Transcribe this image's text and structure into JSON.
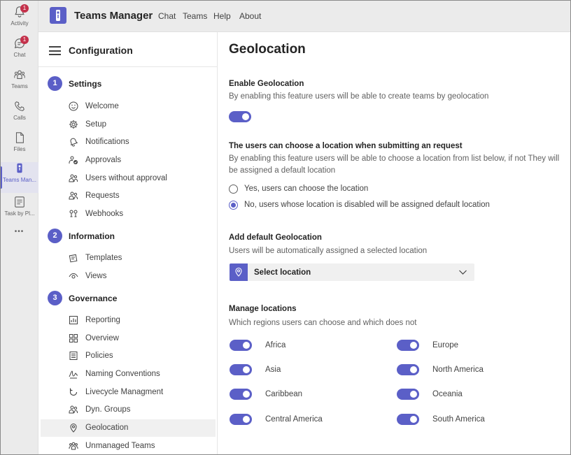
{
  "rail": {
    "items": [
      {
        "label": "Activity",
        "icon": "bell-icon",
        "badge": "1"
      },
      {
        "label": "Chat",
        "icon": "chat-icon",
        "badge": "1"
      },
      {
        "label": "Teams",
        "icon": "teams-icon"
      },
      {
        "label": "Calls",
        "icon": "phone-icon"
      },
      {
        "label": "Files",
        "icon": "file-icon"
      },
      {
        "label": "Teams Man...",
        "icon": "teams-manager-icon"
      },
      {
        "label": "Task by Pl...",
        "icon": "task-icon"
      }
    ],
    "more": "•••"
  },
  "header": {
    "app_title": "Teams Manager",
    "links": [
      "Chat",
      "Teams",
      "Help",
      "About"
    ]
  },
  "config": {
    "title": "Configuration",
    "sections": [
      {
        "number": "1",
        "title": "Settings",
        "items": [
          {
            "label": "Welcome",
            "icon": "smiley-icon"
          },
          {
            "label": "Setup",
            "icon": "gear-icon"
          },
          {
            "label": "Notifications",
            "icon": "bell-ring-icon"
          },
          {
            "label": "Approvals",
            "icon": "people-check-icon"
          },
          {
            "label": "Users without approval",
            "icon": "people-icon"
          },
          {
            "label": "Requests",
            "icon": "people-request-icon"
          },
          {
            "label": "Webhooks",
            "icon": "webhook-icon"
          }
        ]
      },
      {
        "number": "2",
        "title": "Information",
        "items": [
          {
            "label": "Templates",
            "icon": "template-icon"
          },
          {
            "label": "Views",
            "icon": "eye-icon"
          }
        ]
      },
      {
        "number": "3",
        "title": "Governance",
        "items": [
          {
            "label": "Reporting",
            "icon": "chart-icon"
          },
          {
            "label": "Overview",
            "icon": "grid-icon"
          },
          {
            "label": "Policies",
            "icon": "list-icon"
          },
          {
            "label": "Naming Conventions",
            "icon": "signature-icon"
          },
          {
            "label": "Livecycle Managment",
            "icon": "cycle-icon"
          },
          {
            "label": "Dyn. Groups",
            "icon": "group-icon"
          },
          {
            "label": "Geolocation",
            "icon": "location-pin-icon",
            "active": true
          },
          {
            "label": "Unmanaged Teams",
            "icon": "team-group-icon"
          }
        ]
      }
    ]
  },
  "main": {
    "title": "Geolocation",
    "enable": {
      "title": "Enable Geolocation",
      "description": "By enabling this feature users will be able to create teams by geolocation",
      "on": true
    },
    "choose": {
      "title": "The users can choose a location when submitting an request",
      "description_line1": "By enabling this feature users will be able to choose a location from list below, if not They will",
      "description_line2": "be assigned a default location",
      "options": [
        {
          "label": "Yes, users can choose the location",
          "checked": false
        },
        {
          "label": "No, users whose location is disabled will be assigned default location",
          "checked": true
        }
      ]
    },
    "default_geo": {
      "title": "Add default Geolocation",
      "description": "Users will be automatically assigned a selected location",
      "select_value": "Select location"
    },
    "manage": {
      "title": "Manage locations",
      "description": "Which regions users can choose and which does not",
      "regions": [
        {
          "label": "Africa",
          "on": true
        },
        {
          "label": "Europe",
          "on": true
        },
        {
          "label": "Asia",
          "on": true
        },
        {
          "label": "North America",
          "on": true
        },
        {
          "label": "Caribbean",
          "on": true
        },
        {
          "label": "Oceania",
          "on": true
        },
        {
          "label": "Central America",
          "on": true
        },
        {
          "label": "South America",
          "on": true
        }
      ]
    }
  },
  "colors": {
    "accent": "#5b5fc7",
    "badge": "#c4314b",
    "rail_bg": "#ebebeb"
  }
}
